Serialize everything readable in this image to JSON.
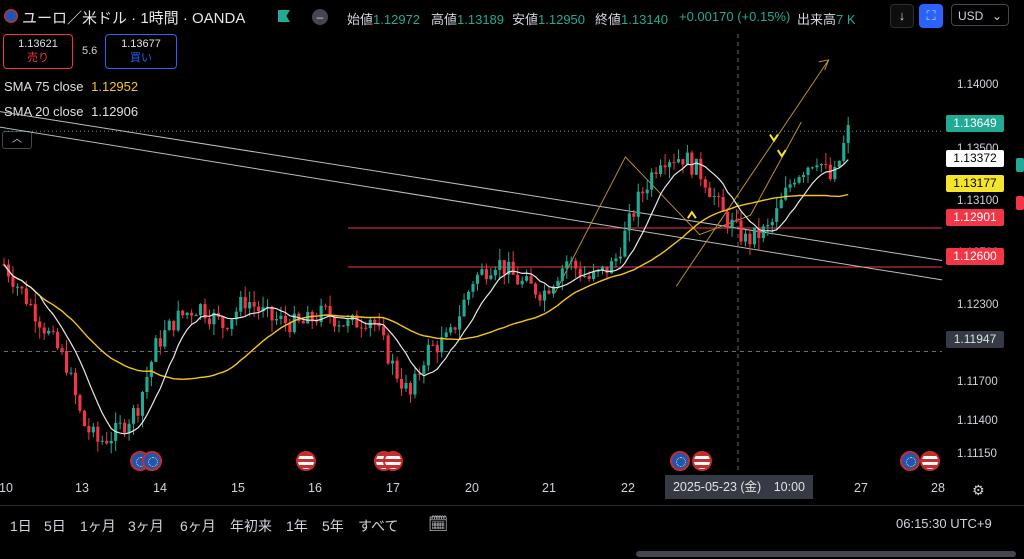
{
  "header": {
    "symbol_title": "ユーロ／米ドル · 1時間 · OANDA",
    "open_label": "始値",
    "open_value": "1.12972",
    "high_label": "高値",
    "high_value": "1.13189",
    "low_label": "安値",
    "low_value": "1.12950",
    "close_label": "終値",
    "close_value": "1.13140",
    "change_value": "+0.00170 (+0.15%)",
    "volume_label": "出来高",
    "volume_value": "7 K",
    "currency": "USD",
    "currency_chevron": "⌄",
    "download_icon": "↓",
    "fullscreen_icon": "⛶",
    "eye_icon": "–"
  },
  "quotes": {
    "sell_price": "1.13621",
    "sell_label": "売り",
    "spread": "5.6",
    "buy_price": "1.13677",
    "buy_label": "買い"
  },
  "indicators": {
    "sma75_label": "SMA 75 close",
    "sma75_value": "1.12952",
    "sma20_label": "SMA 20 close",
    "sma20_value": "1.12906",
    "collapse_icon": "︿"
  },
  "price_axis": {
    "ticks": [
      "1.14000",
      "1.13500",
      "1.13100",
      "1.12700",
      "1.12300",
      "1.11700",
      "1.11400",
      "1.11150"
    ],
    "tags": {
      "current": "1.13649",
      "sma20": "1.13372",
      "sma75": "1.13177",
      "line_upper": "1.12901",
      "line_lower": "1.12600",
      "crosshair": "1.11947"
    }
  },
  "time_axis": {
    "labels": [
      "10",
      "13",
      "14",
      "15",
      "16",
      "17",
      "20",
      "21",
      "22",
      "27",
      "28"
    ],
    "crosshair_date": "2025-05-23 (金)　10:00"
  },
  "bottom_bar": {
    "ranges": [
      "1日",
      "5日",
      "1ヶ月",
      "3ヶ月",
      "6ヶ月",
      "年初来",
      "1年",
      "5年",
      "すべて"
    ],
    "clock": "06:15:30 UTC+9"
  },
  "colors": {
    "up": "#22ab94",
    "down": "#f23645",
    "sma75": "#f5c518",
    "sma20": "#e8e8e8",
    "hline": "#f23645",
    "accent": "#2962ff"
  },
  "chart_data": {
    "type": "candlestick",
    "symbol": "EURUSD",
    "timeframe": "1h",
    "ylim": [
      1.11,
      1.144
    ],
    "yticks": [
      1.14,
      1.135,
      1.131,
      1.127,
      1.123,
      1.117,
      1.114,
      1.1115
    ],
    "current_price": 1.13649,
    "horizontal_lines": [
      1.12901,
      1.126
    ],
    "crosshair_price": 1.11947,
    "sma75_last": 1.13177,
    "sma20_last": 1.13372,
    "close_path": [
      [
        0,
        1.1262
      ],
      [
        0.4,
        1.1225
      ],
      [
        0.8,
        1.1185
      ],
      [
        1.0,
        1.114
      ],
      [
        1.2,
        1.1125
      ],
      [
        1.4,
        1.113
      ],
      [
        1.7,
        1.115
      ],
      [
        1.95,
        1.12
      ],
      [
        2.2,
        1.122
      ],
      [
        2.5,
        1.123
      ],
      [
        2.8,
        1.1215
      ],
      [
        3.1,
        1.1235
      ],
      [
        3.4,
        1.122
      ],
      [
        3.8,
        1.1215
      ],
      [
        4.1,
        1.1225
      ],
      [
        4.4,
        1.1215
      ],
      [
        4.7,
        1.1222
      ],
      [
        5.0,
        1.118
      ],
      [
        5.2,
        1.116
      ],
      [
        5.4,
        1.1195
      ],
      [
        5.7,
        1.1205
      ],
      [
        6.0,
        1.125
      ],
      [
        6.3,
        1.1265
      ],
      [
        6.6,
        1.1248
      ],
      [
        6.9,
        1.124
      ],
      [
        7.2,
        1.1265
      ],
      [
        7.5,
        1.125
      ],
      [
        7.8,
        1.1262
      ],
      [
        8.1,
        1.131
      ],
      [
        8.4,
        1.1345
      ],
      [
        8.7,
        1.1345
      ],
      [
        8.95,
        1.133
      ],
      [
        9.2,
        1.13
      ],
      [
        9.5,
        1.128
      ],
      [
        9.8,
        1.129
      ],
      [
        10.1,
        1.133
      ],
      [
        10.4,
        1.1345
      ],
      [
        10.6,
        1.1325
      ],
      [
        10.8,
        1.1365
      ]
    ]
  }
}
